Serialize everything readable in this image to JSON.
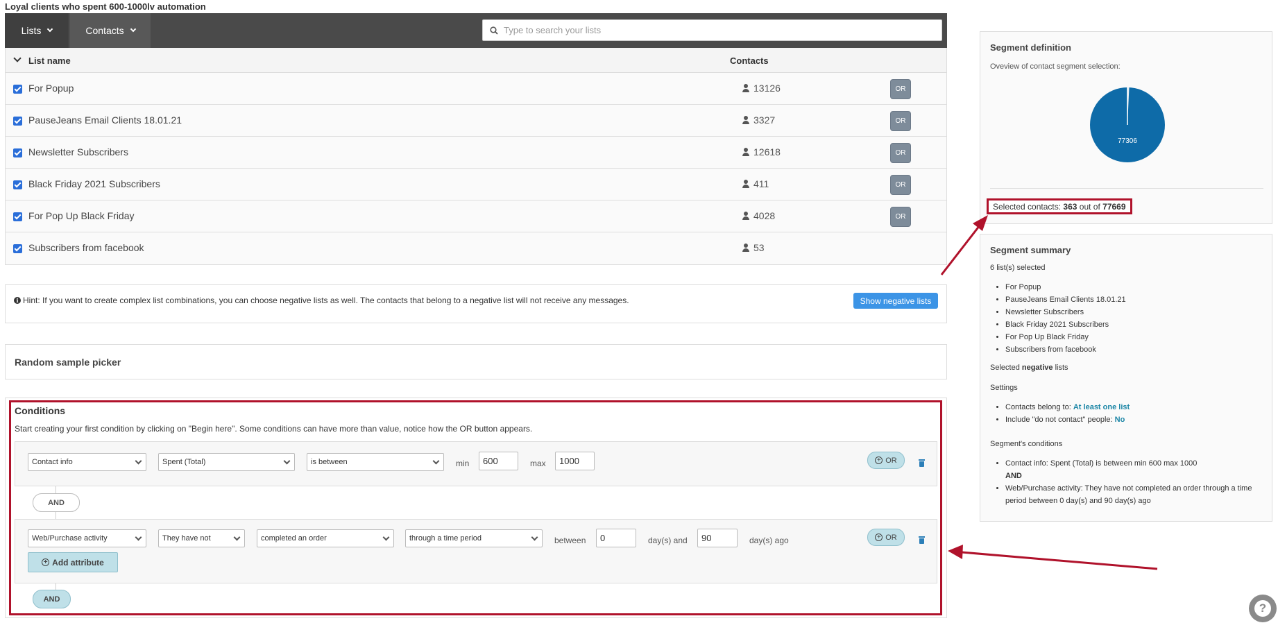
{
  "page": {
    "title": "Loyal clients who spent 600-1000lv automation"
  },
  "toolbar": {
    "lists_label": "Lists",
    "contacts_label": "Contacts",
    "search_placeholder": "Type to search your lists"
  },
  "lists_table": {
    "col_name": "List name",
    "col_contacts": "Contacts",
    "or_label": "OR",
    "rows": [
      {
        "name": "For Popup",
        "contacts": "13126"
      },
      {
        "name": "PauseJeans Email Clients 18.01.21",
        "contacts": "3327"
      },
      {
        "name": "Newsletter Subscribers",
        "contacts": "12618"
      },
      {
        "name": "Black Friday 2021 Subscribers",
        "contacts": "411"
      },
      {
        "name": "For Pop Up Black Friday",
        "contacts": "4028"
      },
      {
        "name": "Subscribers from facebook",
        "contacts": "53"
      }
    ]
  },
  "hint": {
    "text": "Hint: If you want to create complex list combinations, you can choose negative lists as well. The contacts that belong to a negative list will not receive any messages.",
    "button": "Show negative lists"
  },
  "random_sample": {
    "title": "Random sample picker"
  },
  "conditions": {
    "title": "Conditions",
    "intro": "Start creating your first condition by clicking on \"Begin here\". Some conditions can have more than value, notice how the OR button appears.",
    "c1": {
      "field1": "Contact info",
      "field2": "Spent (Total)",
      "operator": "is between",
      "min_label": "min",
      "min_value": "600",
      "max_label": "max",
      "max_value": "1000",
      "or_label": "OR"
    },
    "and_label": "AND",
    "c2": {
      "field1": "Web/Purchase activity",
      "field2": "They have not",
      "field3": "completed an order",
      "field4": "through a time period",
      "between_label": "between",
      "from_value": "0",
      "days_and_label": "day(s) and",
      "to_value": "90",
      "days_ago_label": "day(s) ago",
      "or_label": "OR",
      "add_attribute": "Add attribute"
    },
    "and_label_2": "AND"
  },
  "segment_definition": {
    "title": "Segment definition",
    "subtitle": "Oveview of contact segment selection:",
    "pie_label": "77306",
    "selected_prefix": "Selected contacts:",
    "selected_count": "363",
    "out_of": "out of",
    "total": "77669",
    "colors": {
      "pie": "#0e6ba8",
      "highlight": "#b0122b"
    }
  },
  "segment_summary": {
    "title": "Segment summary",
    "lists_count": "6",
    "lists_selected_suffix": "list(s) selected",
    "lists": [
      "For Popup",
      "PauseJeans Email Clients 18.01.21",
      "Newsletter Subscribers",
      "Black Friday 2021 Subscribers",
      "For Pop Up Black Friday",
      "Subscribers from facebook"
    ],
    "selected_prefix": "Selected",
    "negative_word": "negative",
    "lists_word": "lists",
    "settings_label": "Settings",
    "belong_label": "Contacts belong to:",
    "belong_value": "At least one list",
    "dnc_label": "Include \"do not contact\" people:",
    "dnc_value": "No",
    "conditions_label": "Segment's conditions",
    "cond1": "Contact info: Spent (Total) is between min 600 max 1000",
    "and_label": "AND",
    "cond2": "Web/Purchase activity: They have not completed an order through a time period between 0 day(s) and 90 day(s) ago"
  },
  "help": {
    "label": "?"
  }
}
